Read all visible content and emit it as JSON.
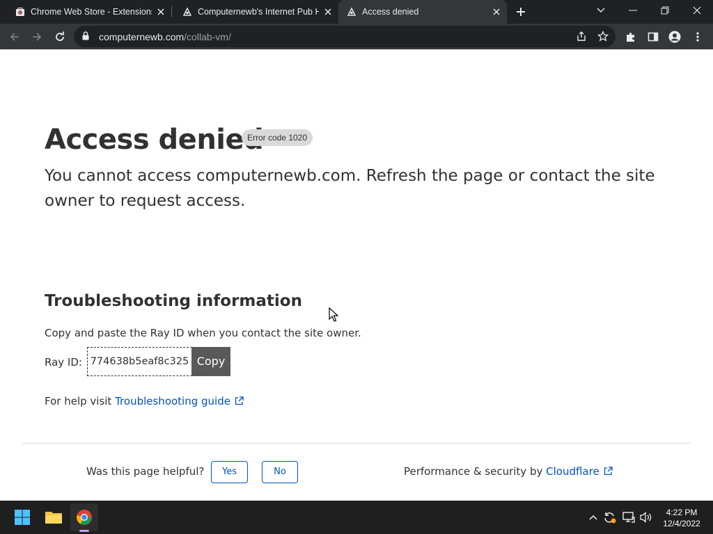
{
  "browser": {
    "tabs": [
      {
        "title": "Chrome Web Store - Extensions",
        "icon": "chrome-web-store-icon"
      },
      {
        "title": "Computernewb's Internet Pub Hub",
        "icon": "computernewb-icon"
      },
      {
        "title": "Access denied",
        "icon": "computernewb-icon"
      }
    ],
    "url_host": "computernewb.com",
    "url_path": "/collab-vm/"
  },
  "page": {
    "heading": "Access denied",
    "error_badge": "Error code 1020",
    "lead": "You cannot access computernewb.com. Refresh the page or contact the site owner to request access.",
    "troubleshooting_heading": "Troubleshooting information",
    "copy_instructions": "Copy and paste the Ray ID when you contact the site owner.",
    "ray_label": "Ray ID:",
    "ray_id": "774638b5eaf8c325",
    "copy_button": "Copy",
    "help_prefix": "For help visit",
    "help_link": "Troubleshooting guide",
    "feedback_question": "Was this page helpful?",
    "yes_button": "Yes",
    "no_button": "No",
    "performance_prefix": "Performance & security by",
    "cloudflare_link": "Cloudflare"
  },
  "taskbar": {
    "time": "4:22 PM",
    "date": "12/4/2022"
  },
  "colors": {
    "link": "#0051c3",
    "text": "#313131",
    "chrome_dark": "#202124"
  }
}
